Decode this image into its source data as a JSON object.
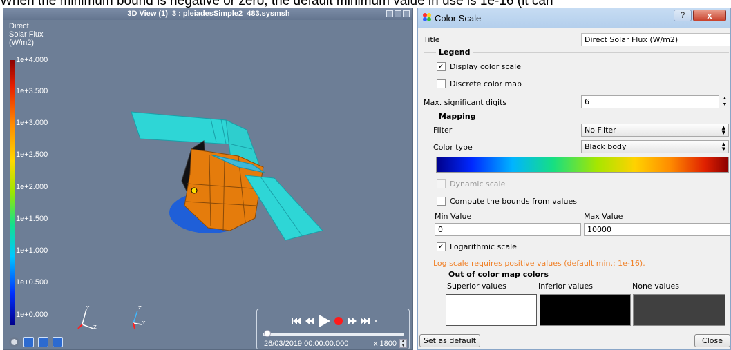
{
  "caption": "When the minimum bound is negative or zero, the default minimum value in use is 1e-16 (it can",
  "view": {
    "title": "3D View (1)_3 : pleiadesSimple2_483.sysmsh",
    "legend_title": [
      "Direct",
      "Solar Flux",
      "(W/m2)"
    ],
    "ticks": [
      "1e+4.000",
      "1e+3.500",
      "1e+3.000",
      "1e+2.500",
      "1e+2.000",
      "1e+1.500",
      "1e+1.000",
      "1e+0.500",
      "1e+0.000"
    ],
    "axis_labels": {
      "y1": "Y",
      "z1": "Z",
      "x1": "X",
      "z2": "Z",
      "y2": "Y",
      "x2": "X"
    },
    "date": "26/03/2019 00:00:00.000",
    "speed": "x 1800",
    "time_progress": 0.0
  },
  "dialog": {
    "title": "Color Scale",
    "help_label": "?",
    "close_label": "x",
    "title_label": "Title",
    "title_value": "Direct Solar Flux (W/m2)",
    "legend_header": "Legend",
    "display_color_scale": "Display color scale",
    "display_color_scale_checked": true,
    "discrete_color_map": "Discrete color map",
    "discrete_color_map_checked": false,
    "max_digits_label": "Max. significant digits",
    "max_digits_value": "6",
    "mapping_header": "Mapping",
    "filter_label": "Filter",
    "filter_value": "No Filter",
    "color_type_label": "Color type",
    "color_type_value": "Black body",
    "dynamic_scale": "Dynamic scale",
    "dynamic_scale_checked": false,
    "compute_bounds": "Compute the bounds from values",
    "compute_bounds_checked": false,
    "min_label": "Min Value",
    "min_value": "0",
    "max_label": "Max Value",
    "max_value": "10000",
    "log_scale": "Logarithmic scale",
    "log_scale_checked": true,
    "warning": "Log scale requires positive values (default min.: 1e-16).",
    "warning_color": "#f0822a",
    "out_of_map_header": "Out of color map colors",
    "superior_label": "Superior values",
    "inferior_label": "Inferior values",
    "none_label": "None values",
    "superior_color": "#ffffff",
    "inferior_color": "#000000",
    "none_color": "#404040",
    "set_default_label": "Set as default",
    "close_button_label": "Close"
  }
}
